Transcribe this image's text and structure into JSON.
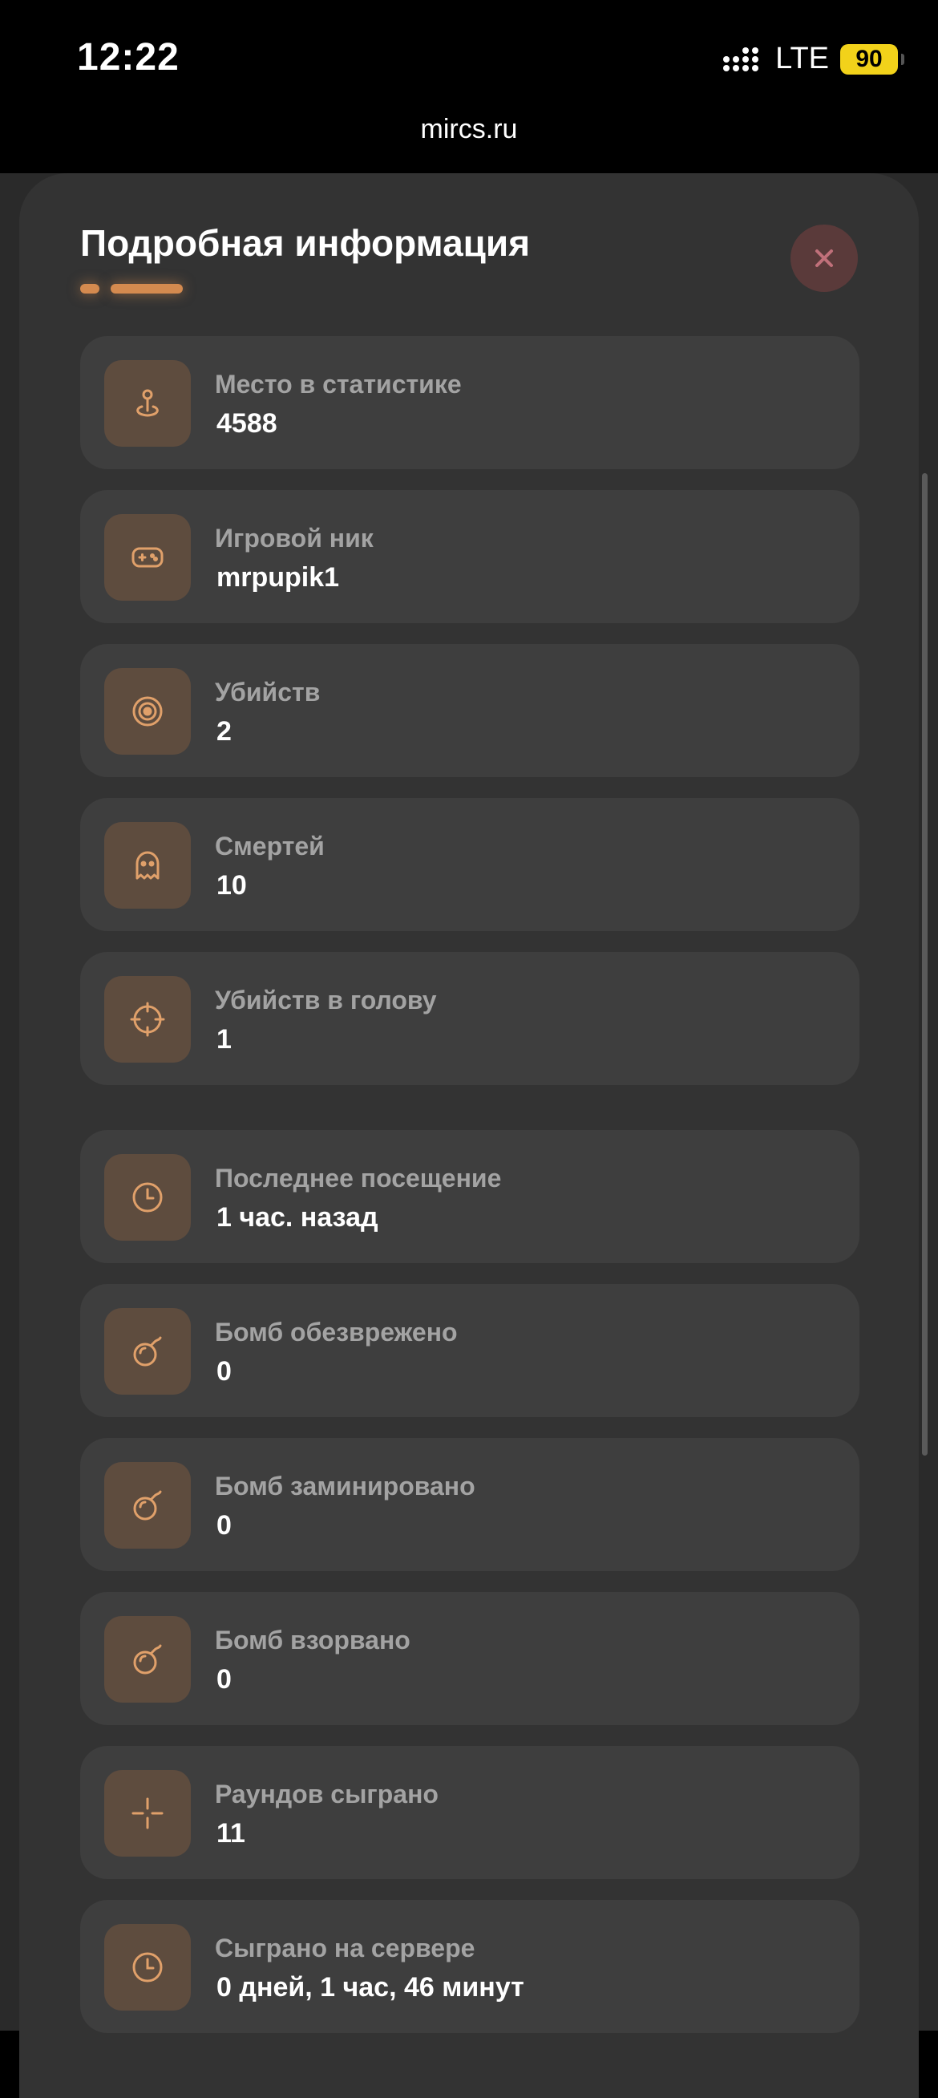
{
  "status_bar": {
    "time": "12:22",
    "network": "LTE",
    "battery": "90"
  },
  "browser": {
    "url": "mircs.ru"
  },
  "modal": {
    "title": "Подробная информация",
    "close_icon": "close-icon"
  },
  "colors": {
    "accent": "#d48a4f",
    "card_bg": "#3e3e3e",
    "icon_bg": "#5e4c3e",
    "sheet_bg": "#333333",
    "close_bg": "#5a3a3a",
    "close_icon": "#c0707a",
    "battery": "#f2d21a"
  },
  "stats": [
    {
      "icon": "map-pin-icon",
      "label": "Место в статистике",
      "value": "4588"
    },
    {
      "icon": "gamepad-icon",
      "label": "Игровой ник",
      "value": "mrpupik1"
    },
    {
      "icon": "target-icon",
      "label": "Убийств",
      "value": "2"
    },
    {
      "icon": "ghost-icon",
      "label": "Смертей",
      "value": "10"
    },
    {
      "icon": "crosshair-icon",
      "label": "Убийств в голову",
      "value": "1"
    },
    {
      "icon": "clock-icon",
      "label": "Последнее посещение",
      "value": "1 час. назад"
    },
    {
      "icon": "bomb-icon",
      "label": "Бомб обезврежено",
      "value": "0"
    },
    {
      "icon": "bomb-icon",
      "label": "Бомб заминировано",
      "value": "0"
    },
    {
      "icon": "bomb-icon",
      "label": "Бомб взорвано",
      "value": "0"
    },
    {
      "icon": "plus-crosshair-icon",
      "label": "Раундов сыграно",
      "value": "11"
    },
    {
      "icon": "clock-icon",
      "label": "Сыграно на сервере",
      "value": "0 дней, 1 час, 46 минут"
    }
  ]
}
